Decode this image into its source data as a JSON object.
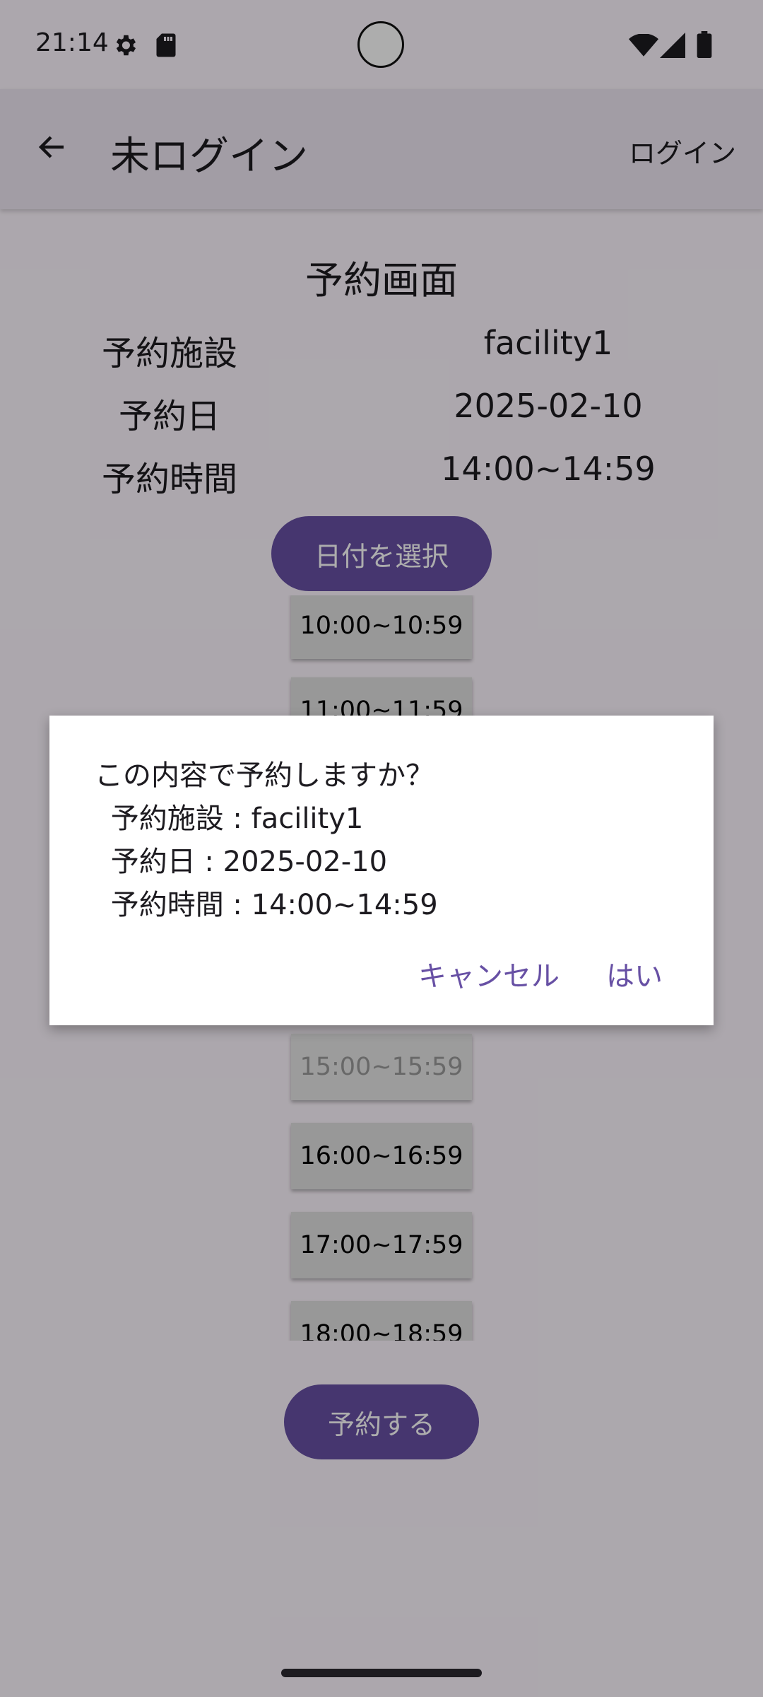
{
  "status_bar": {
    "time": "21:14",
    "icons": [
      "gear-icon",
      "sd-card-icon",
      "wifi-icon",
      "signal-icon",
      "battery-icon"
    ]
  },
  "app_bar": {
    "back_icon": "arrow-back-icon",
    "title": "未ログイン",
    "action_label": "ログイン"
  },
  "screen": {
    "title": "予約画面",
    "info": [
      {
        "label": "予約施設",
        "value": "facility1"
      },
      {
        "label": "予約日",
        "value": "2025-02-10"
      },
      {
        "label": "予約時間",
        "value": "14:00~14:59"
      }
    ],
    "date_button_label": "日付を選択",
    "time_slots": [
      {
        "label": "10:00~10:59",
        "enabled": true
      },
      {
        "label": "11:00~11:59",
        "enabled": true
      },
      {
        "label": "15:00~15:59",
        "enabled": false
      },
      {
        "label": "16:00~16:59",
        "enabled": true
      },
      {
        "label": "17:00~17:59",
        "enabled": true
      },
      {
        "label": "18:00~18:59",
        "enabled": true
      }
    ],
    "reserve_button_label": "予約する"
  },
  "dialog": {
    "question": "この内容で予約しますか？",
    "lines": [
      " 予約施設 : facility1",
      " 予約日 : 2025-02-10",
      " 予約時間 : 14:00~14:59"
    ],
    "cancel_label": "キャンセル",
    "confirm_label": "はい"
  },
  "colors": {
    "primary": "#6750a4",
    "background": "#fef7ff",
    "app_bar": "#efe8f4",
    "slot": "#e0e0e0",
    "scrim": "rgba(0,0,0,0.32)"
  }
}
